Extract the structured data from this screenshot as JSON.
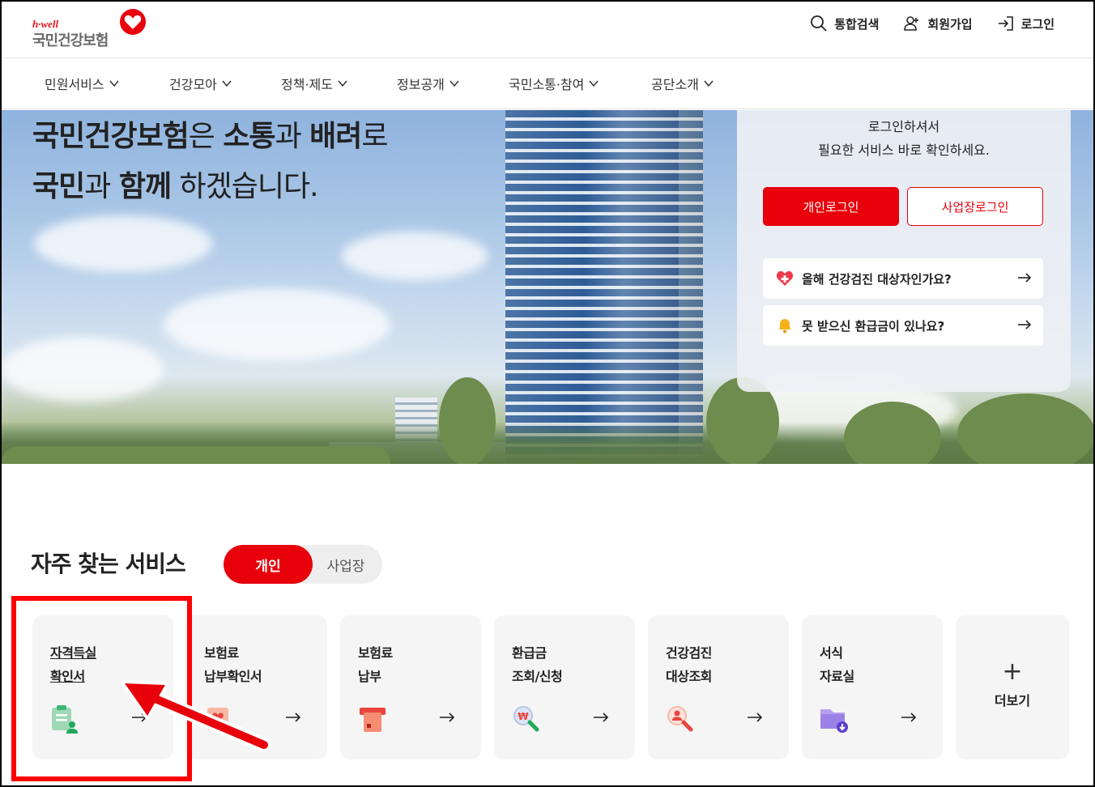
{
  "header": {
    "logo_top": "h·well",
    "logo_main": "국민건강보험",
    "utils": [
      {
        "label": "통합검색",
        "icon": "search-icon"
      },
      {
        "label": "회원가입",
        "icon": "user-add-icon"
      },
      {
        "label": "로그인",
        "icon": "login-icon"
      }
    ]
  },
  "gnb": [
    {
      "label": "민원서비스"
    },
    {
      "label": "건강모아"
    },
    {
      "label": "정책·제도"
    },
    {
      "label": "정보공개"
    },
    {
      "label": "국민소통·참여"
    },
    {
      "label": "공단소개"
    }
  ],
  "hero": {
    "line1_a": "국민건강보험",
    "line1_b": "은 ",
    "line1_c": "소통",
    "line1_d": "과 ",
    "line1_e": "배려",
    "line1_f": "로",
    "line2_a": "국민",
    "line2_b": "과 ",
    "line2_c": "함께",
    "line2_d": " 하겠습니다."
  },
  "login": {
    "message_line1": "로그인하셔서",
    "message_line2": "필요한 서비스 바로 확인하세요.",
    "personal_label": "개인로그인",
    "business_label": "사업장로그인",
    "quick_links": [
      {
        "label": "올해 건강검진 대상자인가요?",
        "icon": "heart-plus-icon"
      },
      {
        "label": "못 받으신 환급금이 있나요?",
        "icon": "bell-icon"
      }
    ]
  },
  "frequent": {
    "title": "자주 찾는 서비스",
    "tab_personal": "개인",
    "tab_business": "사업장",
    "cards": [
      {
        "line1": "자격득실",
        "line2": "확인서",
        "icon": "certificate-user-icon"
      },
      {
        "line1": "보험료",
        "line2": "납부확인서",
        "icon": "heart-document-icon"
      },
      {
        "line1": "보험료",
        "line2": "납부",
        "icon": "card-payment-icon"
      },
      {
        "line1": "환급금",
        "line2": "조회/신청",
        "icon": "won-search-icon"
      },
      {
        "line1": "건강검진",
        "line2": "대상조회",
        "icon": "person-search-icon"
      },
      {
        "line1": "서식",
        "line2": "자료실",
        "icon": "folder-download-icon"
      }
    ],
    "more_plus": "+",
    "more_label": "더보기"
  },
  "colors": {
    "brand_red": "#e8000a",
    "annotation_red": "#ff0000"
  }
}
